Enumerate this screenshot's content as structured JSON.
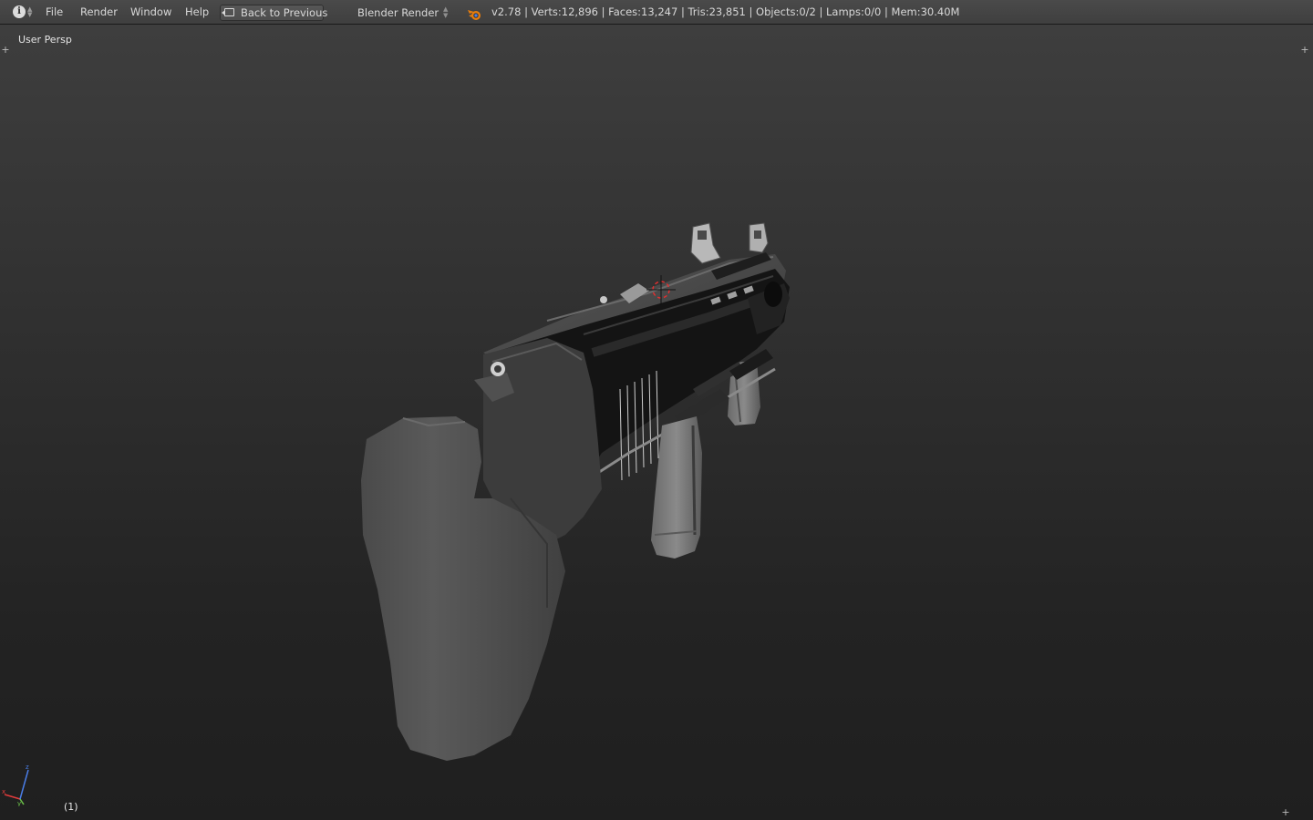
{
  "menu": {
    "file": "File",
    "render": "Render",
    "window": "Window",
    "help": "Help"
  },
  "header": {
    "back_label": "Back to Previous",
    "engine": "Blender Render",
    "stats": "v2.78 | Verts:12,896 | Faces:13,247 | Tris:23,851 | Objects:0/2 | Lamps:0/0 | Mem:30.40M"
  },
  "viewport": {
    "view_label": "User Persp",
    "frame_label": "(1)"
  },
  "icons": {
    "editor_type": "info-icon",
    "back": "back-to-previous-icon",
    "logo": "blender-logo-icon",
    "cursor": "3d-cursor-icon",
    "gizmo": "axis-gizmo-icon"
  },
  "colors": {
    "header_bg": "#444444",
    "viewport_top": "#3e3e3e",
    "viewport_bottom": "#1f1f1f",
    "text": "#d8d8d8",
    "logo_orange": "#e87d0d",
    "cursor_red": "#e03030",
    "axis_x": "#e03c3c",
    "axis_y": "#6cc24a",
    "axis_z": "#4a7ee8"
  }
}
